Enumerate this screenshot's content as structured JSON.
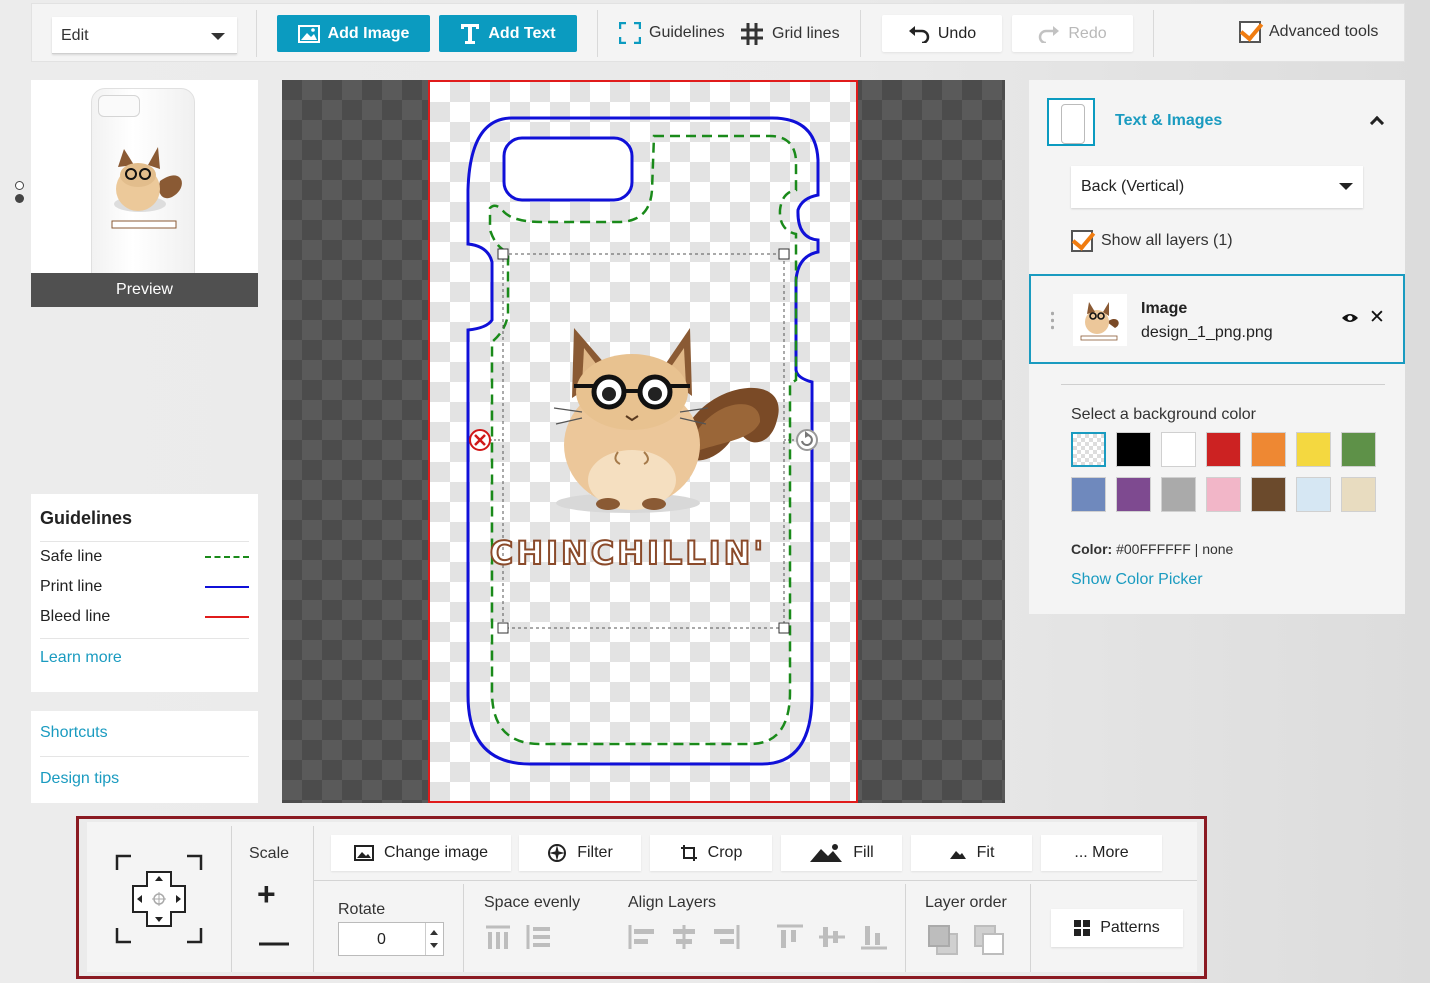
{
  "toolbar": {
    "mode_select": "Edit",
    "add_image": "Add Image",
    "add_text": "Add Text",
    "guidelines": "Guidelines",
    "grid_lines": "Grid lines",
    "undo": "Undo",
    "redo": "Redo",
    "advanced_tools": "Advanced tools"
  },
  "preview": {
    "label": "Preview"
  },
  "guidelines_box": {
    "title": "Guidelines",
    "items": [
      {
        "label": "Safe line",
        "color": "#1a8a1a"
      },
      {
        "label": "Print line",
        "color": "#1010d8"
      },
      {
        "label": "Bleed line",
        "color": "#e01b1b"
      }
    ],
    "learn_more": "Learn more"
  },
  "help_links": {
    "shortcuts": "Shortcuts",
    "design_tips": "Design tips"
  },
  "canvas": {
    "design_text": "CHINCHILLIN'"
  },
  "right_panel": {
    "title": "Text & Images",
    "side_select": "Back (Vertical)",
    "show_all_layers": "Show all layers (1)",
    "layer": {
      "type": "Image",
      "filename": "design_1_png.png"
    },
    "bg_label": "Select a background color",
    "swatches": [
      "transparent",
      "#000000",
      "#ffffff",
      "#cc2222",
      "#ee8833",
      "#f4d840",
      "#5e9148",
      "#6f89bd",
      "#7e4a90",
      "#aaaaaa",
      "#f2b6c8",
      "#6b4a2c",
      "#d6e7f3",
      "#e8dcc0"
    ],
    "color_label": "Color:",
    "color_value": "#00FFFFFF | none",
    "show_picker": "Show Color Picker"
  },
  "bottom_toolbar": {
    "scale": "Scale",
    "change_image": "Change image",
    "filter": "Filter",
    "crop": "Crop",
    "fill": "Fill",
    "fit": "Fit",
    "more": "... More",
    "rotate": "Rotate",
    "rotate_value": "0",
    "space_evenly": "Space evenly",
    "align_layers": "Align Layers",
    "layer_order": "Layer order",
    "patterns": "Patterns"
  }
}
